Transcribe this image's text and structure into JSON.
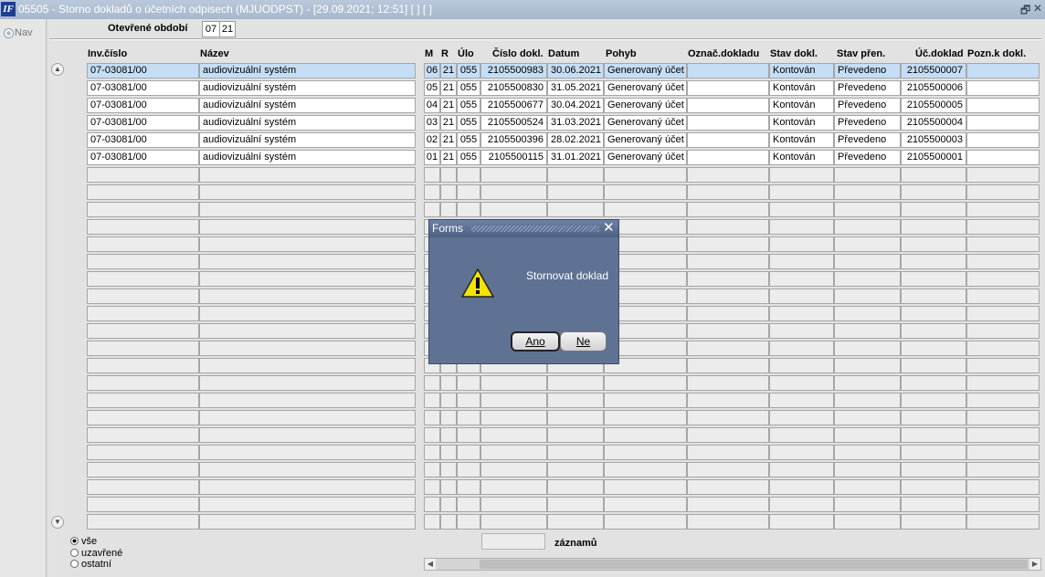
{
  "window": {
    "title": "05505 - Storno dokladů o účetních odpisech (MJUODPST) - [29.09.2021; 12:51]  [ ]  [ ]",
    "app_icon": "IF",
    "restore_glyph": "🗗",
    "close_glyph": "✕"
  },
  "nav": {
    "label": "Nav"
  },
  "period": {
    "label": "Otevřené období",
    "month": "07",
    "year": "21"
  },
  "table": {
    "headers": {
      "inv": "Inv.číslo",
      "nazev": "Název",
      "m": "M",
      "r": "R",
      "ulo": "Úlo",
      "cislo": "Číslo dokl.",
      "datum": "Datum",
      "pohyb": "Pohyb",
      "oznac": "Označ.dokladu",
      "stav": "Stav dokl.",
      "prenos": "Stav přen.",
      "ucdoklad": "Úč.doklad",
      "pozn": "Pozn.k dokl."
    },
    "rows": [
      {
        "inv": "07-03081/00",
        "nazev": "audiovizuální systém",
        "m": "06",
        "r": "21",
        "ulo": "055",
        "cislo": "2105500983",
        "datum": "30.06.2021",
        "pohyb": "Generovaný účet",
        "oznac": "",
        "stav": "Kontován",
        "prenos": "Převedeno",
        "ucdoklad": "2105500007",
        "pozn": ""
      },
      {
        "inv": "07-03081/00",
        "nazev": "audiovizuální systém",
        "m": "05",
        "r": "21",
        "ulo": "055",
        "cislo": "2105500830",
        "datum": "31.05.2021",
        "pohyb": "Generovaný účet",
        "oznac": "",
        "stav": "Kontován",
        "prenos": "Převedeno",
        "ucdoklad": "2105500006",
        "pozn": ""
      },
      {
        "inv": "07-03081/00",
        "nazev": "audiovizuální systém",
        "m": "04",
        "r": "21",
        "ulo": "055",
        "cislo": "2105500677",
        "datum": "30.04.2021",
        "pohyb": "Generovaný účet",
        "oznac": "",
        "stav": "Kontován",
        "prenos": "Převedeno",
        "ucdoklad": "2105500005",
        "pozn": ""
      },
      {
        "inv": "07-03081/00",
        "nazev": "audiovizuální systém",
        "m": "03",
        "r": "21",
        "ulo": "055",
        "cislo": "2105500524",
        "datum": "31.03.2021",
        "pohyb": "Generovaný účet",
        "oznac": "",
        "stav": "Kontován",
        "prenos": "Převedeno",
        "ucdoklad": "2105500004",
        "pozn": ""
      },
      {
        "inv": "07-03081/00",
        "nazev": "audiovizuální systém",
        "m": "02",
        "r": "21",
        "ulo": "055",
        "cislo": "2105500396",
        "datum": "28.02.2021",
        "pohyb": "Generovaný účet",
        "oznac": "",
        "stav": "Kontován",
        "prenos": "Převedeno",
        "ucdoklad": "2105500003",
        "pozn": ""
      },
      {
        "inv": "07-03081/00",
        "nazev": "audiovizuální systém",
        "m": "01",
        "r": "21",
        "ulo": "055",
        "cislo": "2105500115",
        "datum": "31.01.2021",
        "pohyb": "Generovaný účet",
        "oznac": "",
        "stav": "Kontován",
        "prenos": "Převedeno",
        "ucdoklad": "2105500001",
        "pozn": ""
      }
    ],
    "empty_rows": 21,
    "selected_row": 0,
    "selected_color": "#c5def5"
  },
  "filter": {
    "options": [
      {
        "label": "vše",
        "selected": true
      },
      {
        "label": "uzavřené",
        "selected": false
      },
      {
        "label": "ostatní",
        "selected": false
      }
    ]
  },
  "count": {
    "value": "",
    "label": "záznamů"
  },
  "dialog": {
    "title": "Forms",
    "close_glyph": "✕",
    "icon": "warning-icon",
    "message": "Stornovat doklad",
    "yes_label": "Ano",
    "no_label": "Ne",
    "background": "#5f7294"
  }
}
